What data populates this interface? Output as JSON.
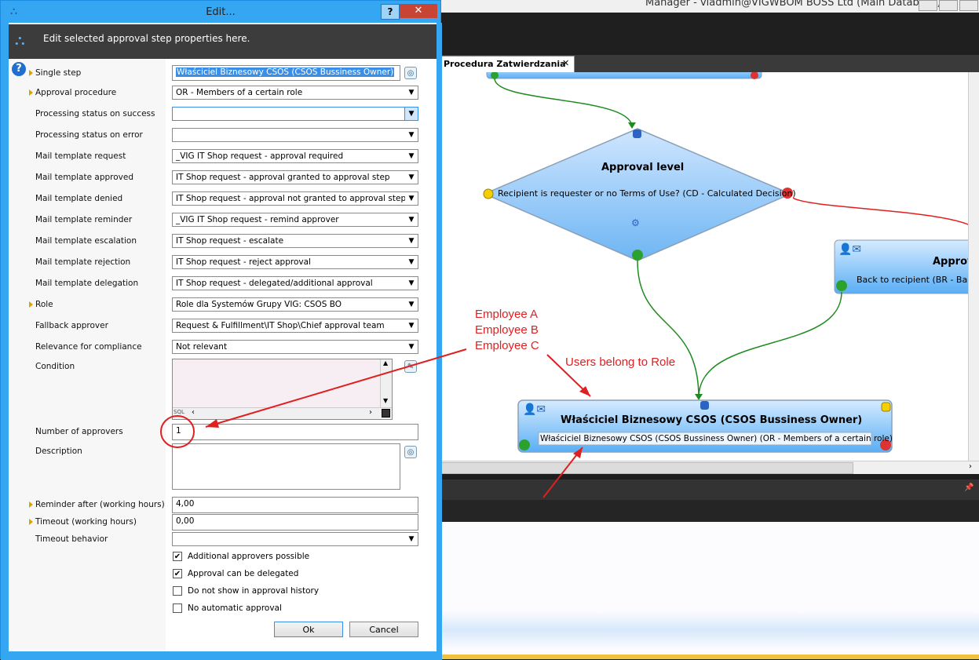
{
  "background": {
    "title": "Manager - viadmin@VIGWBOM BOSS Ltd (Main Database)",
    "tab_label": "Procedura Zatwierdzania",
    "tab_close": "✕",
    "nodes": {
      "approval_level_title": "Approval level",
      "approval_level_text": "Recipient is requester or no Terms of Use? (CD - Calculated Decision)",
      "approval_right_title": "Approva",
      "approval_right_text": "Back to recipient (BR - Back to r",
      "owner_title": "Właściciel Biznesowy CSOS (CSOS  Bussiness Owner)",
      "owner_text": "Właściciel Biznesowy CSOS (CSOS Bussiness Owner) (OR - Members of a certain role)"
    },
    "pin_icon": "📌"
  },
  "dialog": {
    "title": "Edit...",
    "help_label": "?",
    "close_label": "✕",
    "header": "Edit selected approval step properties here.",
    "help_icon": "question-icon",
    "fields": {
      "single_step": {
        "label": "Single step",
        "value": "Właściciel Biznesowy CSOS (CSOS Bussiness Owner)"
      },
      "approval_procedure": {
        "label": "Approval procedure",
        "value": "OR - Members of a certain role"
      },
      "status_success": {
        "label": "Processing status on success",
        "value": ""
      },
      "status_error": {
        "label": "Processing status on error",
        "value": ""
      },
      "mail_request": {
        "label": "Mail template request",
        "value": "_VIG IT Shop request - approval required"
      },
      "mail_approved": {
        "label": "Mail template approved",
        "value": "IT Shop request - approval granted to approval step"
      },
      "mail_denied": {
        "label": "Mail template denied",
        "value": "IT Shop request - approval not granted to approval step"
      },
      "mail_reminder": {
        "label": "Mail template reminder",
        "value": "_VIG IT Shop request - remind approver"
      },
      "mail_escalation": {
        "label": "Mail template escalation",
        "value": "IT Shop request - escalate"
      },
      "mail_rejection": {
        "label": "Mail template rejection",
        "value": "IT Shop request - reject approval"
      },
      "mail_delegation": {
        "label": "Mail template delegation",
        "value": "IT Shop request - delegated/additional approval"
      },
      "role": {
        "label": "Role",
        "value": "Role dla Systemów Grupy VIG: CSOS BO"
      },
      "fallback_approver": {
        "label": "Fallback approver",
        "value": "Request & Fulfillment\\IT Shop\\Chief approval team"
      },
      "relevance": {
        "label": "Relevance for compliance",
        "value": "Not relevant"
      },
      "condition": {
        "label": "Condition",
        "value": "",
        "sql_label": "SQL"
      },
      "num_approvers": {
        "label": "Number of approvers",
        "value": "1"
      },
      "description": {
        "label": "Description",
        "value": ""
      },
      "reminder_after": {
        "label": "Reminder after (working hours)",
        "value": "4,00"
      },
      "timeout": {
        "label": "Timeout (working hours)",
        "value": "0,00"
      },
      "timeout_behavior": {
        "label": "Timeout behavior",
        "value": ""
      }
    },
    "checkboxes": [
      {
        "label": "Additional approvers possible",
        "checked": true
      },
      {
        "label": "Approval can be delegated",
        "checked": true
      },
      {
        "label": "Do not show in approval history",
        "checked": false
      },
      {
        "label": "No automatic approval",
        "checked": false
      }
    ],
    "ok_label": "Ok",
    "cancel_label": "Cancel"
  },
  "annotations": {
    "employees": [
      "Employee A",
      "Employee B",
      "Employee C"
    ],
    "users_belong": "Users belong to Role"
  },
  "colors": {
    "dialog_accent": "#35a6f2",
    "annotation": "#e02020",
    "approve_line": "#1f8a1f",
    "reject_line": "#e02020"
  }
}
